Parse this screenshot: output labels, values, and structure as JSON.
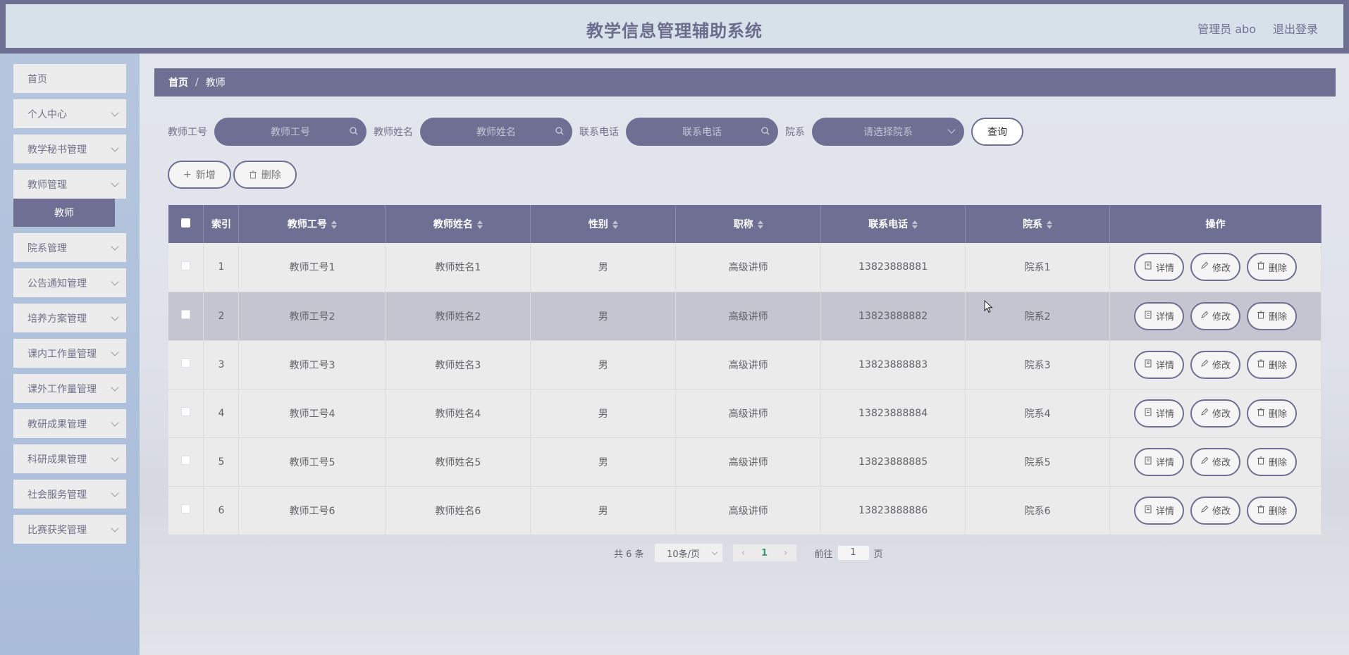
{
  "header": {
    "title": "教学信息管理辅助系统",
    "user": "管理员 abo",
    "logout": "退出登录"
  },
  "sidebar": {
    "items": [
      {
        "label": "首页",
        "chevron": false
      },
      {
        "label": "个人中心",
        "chevron": true
      },
      {
        "label": "教学秘书管理",
        "chevron": true
      },
      {
        "label": "教师管理",
        "chevron": true,
        "sub": "教师"
      },
      {
        "label": "院系管理",
        "chevron": true
      },
      {
        "label": "公告通知管理",
        "chevron": true
      },
      {
        "label": "培养方案管理",
        "chevron": true
      },
      {
        "label": "课内工作量管理",
        "chevron": true
      },
      {
        "label": "课外工作量管理",
        "chevron": true
      },
      {
        "label": "教研成果管理",
        "chevron": true
      },
      {
        "label": "科研成果管理",
        "chevron": true
      },
      {
        "label": "社会服务管理",
        "chevron": true
      },
      {
        "label": "比赛获奖管理",
        "chevron": true
      }
    ]
  },
  "breadcrumb": {
    "home": "首页",
    "sep": "/",
    "current": "教师"
  },
  "search": {
    "id_label": "教师工号",
    "id_placeholder": "教师工号",
    "name_label": "教师姓名",
    "name_placeholder": "教师姓名",
    "phone_label": "联系电话",
    "phone_placeholder": "联系电话",
    "dept_label": "院系",
    "dept_placeholder": "请选择院系",
    "query": "查询"
  },
  "actions": {
    "add": "新增",
    "delete": "删除"
  },
  "table": {
    "headers": [
      "索引",
      "教师工号",
      "教师姓名",
      "性别",
      "职称",
      "联系电话",
      "院系",
      "操作"
    ],
    "rows": [
      {
        "index": "1",
        "id": "教师工号1",
        "name": "教师姓名1",
        "gender": "男",
        "title": "高级讲师",
        "phone": "13823888881",
        "dept": "院系1"
      },
      {
        "index": "2",
        "id": "教师工号2",
        "name": "教师姓名2",
        "gender": "男",
        "title": "高级讲师",
        "phone": "13823888882",
        "dept": "院系2"
      },
      {
        "index": "3",
        "id": "教师工号3",
        "name": "教师姓名3",
        "gender": "男",
        "title": "高级讲师",
        "phone": "13823888883",
        "dept": "院系3"
      },
      {
        "index": "4",
        "id": "教师工号4",
        "name": "教师姓名4",
        "gender": "男",
        "title": "高级讲师",
        "phone": "13823888884",
        "dept": "院系4"
      },
      {
        "index": "5",
        "id": "教师工号5",
        "name": "教师姓名5",
        "gender": "男",
        "title": "高级讲师",
        "phone": "13823888885",
        "dept": "院系5"
      },
      {
        "index": "6",
        "id": "教师工号6",
        "name": "教师姓名6",
        "gender": "男",
        "title": "高级讲师",
        "phone": "13823888886",
        "dept": "院系6"
      }
    ],
    "op_detail": "详情",
    "op_edit": "修改",
    "op_delete": "删除"
  },
  "pagination": {
    "total": "共 6 条",
    "page_size": "10条/页",
    "current": "1",
    "goto_prefix": "前往",
    "goto_value": "1",
    "goto_suffix": "页"
  },
  "colors": {
    "primary": "#6e6f92",
    "header_bg": "#d6e1ea",
    "sidebar_bg": "#b0c2dc",
    "active_page": "#3a9b73"
  }
}
